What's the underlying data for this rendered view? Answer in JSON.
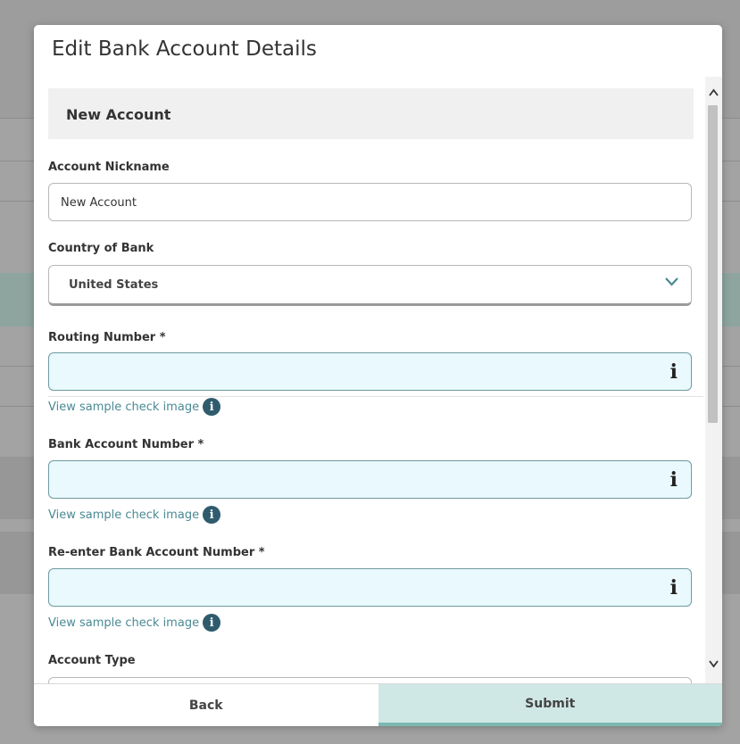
{
  "modal": {
    "title": "Edit Bank Account Details",
    "section_title": "New Account"
  },
  "fields": {
    "nickname": {
      "label": "Account Nickname",
      "value": "New Account"
    },
    "country": {
      "label": "Country of Bank",
      "value": "United States"
    },
    "routing": {
      "label": "Routing Number *",
      "value": "",
      "link": "View sample check image"
    },
    "account": {
      "label": "Bank Account Number *",
      "value": "",
      "link": "View sample check image"
    },
    "reaccount": {
      "label": "Re-enter Bank Account Number *",
      "value": "",
      "link": "View sample check image"
    },
    "account_type": {
      "label": "Account Type"
    }
  },
  "icons": {
    "field_info": "i",
    "link_info": "i"
  },
  "footer": {
    "back_label": "Back",
    "submit_label": "Submit"
  },
  "colors": {
    "accent": "#2f5b6d",
    "link": "#4a8a94",
    "active_field_bg": "#e9f9fd",
    "submit_bg": "#cfe8e5"
  }
}
